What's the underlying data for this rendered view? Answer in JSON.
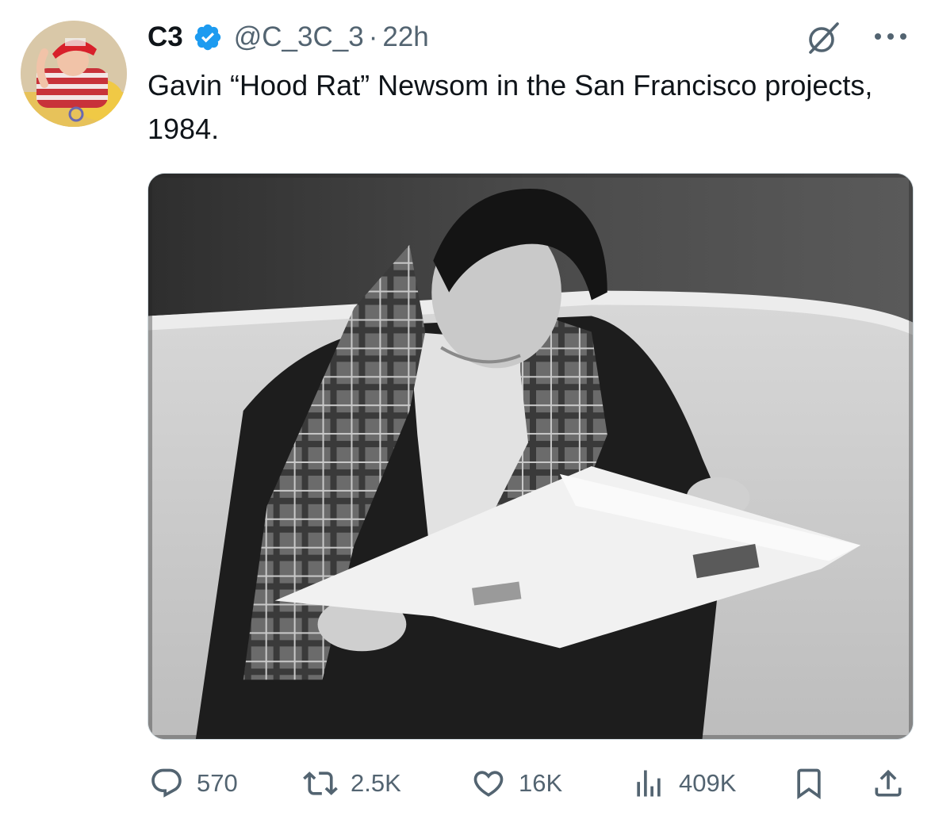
{
  "tweet": {
    "display_name": "C3",
    "handle": "@C_3C_3",
    "separator": "·",
    "time": "22h",
    "text": "Gavin “Hood Rat” Newsom in the San Francisco projects, 1984.",
    "verified_color": "#1d9bf0"
  },
  "actions": {
    "replies": "570",
    "reposts": "2.5K",
    "likes": "16K",
    "views": "409K"
  },
  "icons": {
    "avatar": "avatar-photo",
    "verified": "verified-badge-icon",
    "grok": "grok-icon",
    "more": "more-options-icon",
    "reply": "reply-icon",
    "repost": "repost-icon",
    "like": "heart-icon",
    "views": "analytics-icon",
    "bookmark": "bookmark-icon",
    "share": "share-icon"
  },
  "colors": {
    "text_primary": "#0f1419",
    "text_secondary": "#536471",
    "accent": "#1d9bf0"
  }
}
